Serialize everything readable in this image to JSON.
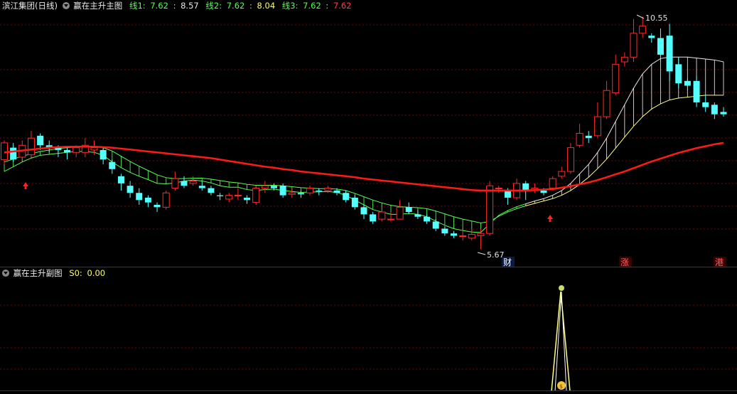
{
  "header": {
    "stock": "滨江集团(日线)",
    "indicator": "赢在主升主图",
    "l1_label": "线1:",
    "l1_value": "7.62",
    "l1_extra": "8.57",
    "l2_label": "线2:",
    "l2_value": "7.62",
    "l2_extra": "8.04",
    "l3_label": "线3:",
    "l3_value": "7.62",
    "l3_extra": "7.62",
    "sep": ":"
  },
  "sub_header": {
    "indicator": "赢在主升副图",
    "s0_label": "S0:",
    "s0_value": "0.00"
  },
  "annotations": {
    "high": "10.55",
    "low": "5.67",
    "marker_cai": "财",
    "marker_zhang": "涨",
    "marker_gang": "港"
  },
  "colors": {
    "up": "#ff2a2a",
    "down": "#54ffff",
    "ma_red": "#ff1a1a",
    "band_green": "#55ff55",
    "band_white": "#f0e6e6",
    "band_yellow": "#ffff80",
    "grid": "#7a0000"
  },
  "candles": [
    [
      7.55,
      7.9,
      7.95,
      7.45
    ],
    [
      7.8,
      7.55,
      7.9,
      7.5
    ],
    [
      7.6,
      7.85,
      7.95,
      7.55
    ],
    [
      7.65,
      8.0,
      8.15,
      7.6
    ],
    [
      8.05,
      7.85,
      8.1,
      7.75
    ],
    [
      7.85,
      7.8,
      7.95,
      7.7
    ],
    [
      7.8,
      7.75,
      7.85,
      7.6
    ],
    [
      7.75,
      7.7,
      7.8,
      7.55
    ],
    [
      7.7,
      7.8,
      7.85,
      7.6
    ],
    [
      7.7,
      7.85,
      8.0,
      7.6
    ],
    [
      7.75,
      7.8,
      7.95,
      7.65
    ],
    [
      7.75,
      7.55,
      7.8,
      7.45
    ],
    [
      7.5,
      7.35,
      7.55,
      7.25
    ],
    [
      7.2,
      7.05,
      7.25,
      6.9
    ],
    [
      7.0,
      6.85,
      7.1,
      6.75
    ],
    [
      6.85,
      6.7,
      6.95,
      6.6
    ],
    [
      6.75,
      6.65,
      6.8,
      6.55
    ],
    [
      6.6,
      6.55,
      6.65,
      6.45
    ],
    [
      6.55,
      6.85,
      6.9,
      6.5
    ],
    [
      6.95,
      7.15,
      7.3,
      6.9
    ],
    [
      7.1,
      7.0,
      7.2,
      6.95
    ],
    [
      7.05,
      7.1,
      7.2,
      7.0
    ],
    [
      7.0,
      6.95,
      7.1,
      6.9
    ],
    [
      6.95,
      6.85,
      7.0,
      6.8
    ],
    [
      6.8,
      6.78,
      6.85,
      6.7
    ],
    [
      6.72,
      6.8,
      6.85,
      6.65
    ],
    [
      6.8,
      6.8,
      6.95,
      6.7
    ],
    [
      6.75,
      6.7,
      6.8,
      6.62
    ],
    [
      6.65,
      6.95,
      7.0,
      6.6
    ],
    [
      6.95,
      7.0,
      7.1,
      6.85
    ],
    [
      7.0,
      6.95,
      7.05,
      6.9
    ],
    [
      7.0,
      6.8,
      7.05,
      6.75
    ],
    [
      6.82,
      6.85,
      6.95,
      6.75
    ],
    [
      6.85,
      6.82,
      6.9,
      6.75
    ],
    [
      6.85,
      6.95,
      7.0,
      6.8
    ],
    [
      6.9,
      6.88,
      6.95,
      6.8
    ],
    [
      6.9,
      6.95,
      7.0,
      6.85
    ],
    [
      6.9,
      6.85,
      6.95,
      6.8
    ],
    [
      6.85,
      6.7,
      6.9,
      6.65
    ],
    [
      6.75,
      6.55,
      6.8,
      6.5
    ],
    [
      6.55,
      6.4,
      6.6,
      6.3
    ],
    [
      6.4,
      6.25,
      6.45,
      6.2
    ],
    [
      6.3,
      6.45,
      6.5,
      6.25
    ],
    [
      6.3,
      6.3,
      6.45,
      6.25
    ],
    [
      6.3,
      6.55,
      6.7,
      6.3
    ],
    [
      6.55,
      6.45,
      6.65,
      6.4
    ],
    [
      6.4,
      6.35,
      6.5,
      6.3
    ],
    [
      6.35,
      6.25,
      6.4,
      6.2
    ],
    [
      6.25,
      6.1,
      6.3,
      6.05
    ],
    [
      6.1,
      6.0,
      6.15,
      5.95
    ],
    [
      6.0,
      5.95,
      6.05,
      5.9
    ],
    [
      5.95,
      5.95,
      6.05,
      5.85
    ],
    [
      5.9,
      5.98,
      6.1,
      5.85
    ],
    [
      5.95,
      6.0,
      6.1,
      5.67
    ],
    [
      6.0,
      7.0,
      7.1,
      5.95
    ],
    [
      6.95,
      6.95,
      7.0,
      6.85
    ],
    [
      6.9,
      6.75,
      6.95,
      6.6
    ],
    [
      6.75,
      7.05,
      7.15,
      6.7
    ],
    [
      7.05,
      6.9,
      7.1,
      6.7
    ],
    [
      6.9,
      6.95,
      7.05,
      6.85
    ],
    [
      6.9,
      6.85,
      6.95,
      6.8
    ],
    [
      6.95,
      7.15,
      7.2,
      6.9
    ],
    [
      7.2,
      7.3,
      7.4,
      7.15
    ],
    [
      7.3,
      7.8,
      7.9,
      7.25
    ],
    [
      7.85,
      8.1,
      8.3,
      7.8
    ],
    [
      8.05,
      8.0,
      8.15,
      7.9
    ],
    [
      8.05,
      8.45,
      8.75,
      8.0
    ],
    [
      8.45,
      9.0,
      9.2,
      8.4
    ],
    [
      8.95,
      9.55,
      9.75,
      8.9
    ],
    [
      9.6,
      9.7,
      9.8,
      9.5
    ],
    [
      9.7,
      10.2,
      10.5,
      9.6
    ],
    [
      10.2,
      10.35,
      10.55,
      10.1
    ],
    [
      10.15,
      10.1,
      10.2,
      10.0
    ],
    [
      10.1,
      9.75,
      10.3,
      9.6
    ],
    [
      10.15,
      9.4,
      10.4,
      9.2
    ],
    [
      9.55,
      9.15,
      9.7,
      9.05
    ],
    [
      9.2,
      9.1,
      9.25,
      9.0
    ],
    [
      9.2,
      8.75,
      9.3,
      8.65
    ],
    [
      8.75,
      8.65,
      8.9,
      8.55
    ],
    [
      8.7,
      8.5,
      8.75,
      8.4
    ],
    [
      8.55,
      8.5,
      8.65,
      8.45
    ]
  ],
  "ma_red": [
    7.7,
    7.72,
    7.74,
    7.76,
    7.78,
    7.8,
    7.81,
    7.82,
    7.82,
    7.82,
    7.82,
    7.81,
    7.8,
    7.78,
    7.76,
    7.74,
    7.72,
    7.7,
    7.68,
    7.66,
    7.64,
    7.62,
    7.6,
    7.58,
    7.55,
    7.52,
    7.49,
    7.46,
    7.43,
    7.4,
    7.38,
    7.35,
    7.33,
    7.3,
    7.28,
    7.26,
    7.24,
    7.22,
    7.2,
    7.18,
    7.15,
    7.13,
    7.11,
    7.09,
    7.07,
    7.05,
    7.03,
    7.01,
    6.99,
    6.97,
    6.95,
    6.93,
    6.91,
    6.9,
    6.9,
    6.9,
    6.9,
    6.9,
    6.9,
    6.91,
    6.92,
    6.93,
    6.96,
    6.99,
    7.03,
    7.07,
    7.12,
    7.18,
    7.24,
    7.3,
    7.37,
    7.44,
    7.51,
    7.57,
    7.63,
    7.69,
    7.74,
    7.79,
    7.83,
    7.87,
    7.9
  ],
  "band_a": [
    7.3,
    7.4,
    7.5,
    7.58,
    7.64,
    7.66,
    7.68,
    7.7,
    7.72,
    7.72,
    7.7,
    7.64,
    7.5,
    7.38,
    7.28,
    7.2,
    7.13,
    7.05,
    7.04,
    7.06,
    7.1,
    7.12,
    7.1,
    7.06,
    7.0,
    6.97,
    6.97,
    6.92,
    6.9,
    6.92,
    6.93,
    6.9,
    6.88,
    6.86,
    6.87,
    6.87,
    6.88,
    6.86,
    6.8,
    6.7,
    6.6,
    6.5,
    6.45,
    6.4,
    6.4,
    6.42,
    6.4,
    6.35,
    6.26,
    6.17,
    6.1,
    6.06,
    6.03,
    6.02,
    6.2,
    6.38,
    6.48,
    6.56,
    6.62,
    6.68,
    6.73,
    6.8,
    6.9,
    7.05,
    7.25,
    7.45,
    7.7,
    8.0,
    8.35,
    8.7,
    9.05,
    9.35,
    9.55,
    9.67,
    9.7,
    9.7,
    9.7,
    9.68,
    9.66,
    9.64,
    9.6
  ],
  "band_b": [
    7.5,
    7.56,
    7.62,
    7.67,
    7.72,
    7.75,
    7.78,
    7.8,
    7.81,
    7.82,
    7.82,
    7.8,
    7.73,
    7.62,
    7.51,
    7.41,
    7.32,
    7.23,
    7.17,
    7.15,
    7.15,
    7.16,
    7.16,
    7.14,
    7.11,
    7.08,
    7.06,
    7.03,
    7.01,
    7.01,
    7.01,
    7.0,
    6.98,
    6.96,
    6.95,
    6.94,
    6.94,
    6.93,
    6.9,
    6.84,
    6.77,
    6.7,
    6.64,
    6.59,
    6.56,
    6.55,
    6.54,
    6.52,
    6.47,
    6.41,
    6.35,
    6.3,
    6.26,
    6.22,
    6.25,
    6.36,
    6.45,
    6.52,
    6.58,
    6.63,
    6.68,
    6.73,
    6.8,
    6.9,
    7.03,
    7.18,
    7.36,
    7.56,
    7.79,
    8.02,
    8.25,
    8.45,
    8.61,
    8.72,
    8.8,
    8.84,
    8.86,
    8.88,
    8.9,
    8.9,
    8.9
  ]
}
